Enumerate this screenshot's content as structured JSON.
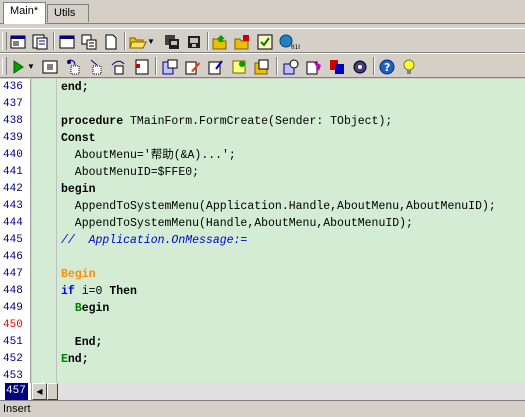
{
  "tabs": [
    {
      "label": "Main*",
      "active": true
    },
    {
      "label": "Utils",
      "active": false
    }
  ],
  "toolbar1_icons": [
    "view-unit-icon",
    "view-form-icon",
    "window-icon",
    "copy-window-icon",
    "new-file-icon",
    "open-folder-icon",
    "dropdown-arrow-icon",
    "save-all-icon",
    "compile-icon",
    "open-project-icon",
    "project-manager-icon",
    "checklist-icon",
    "component-icon"
  ],
  "toolbar2_icons": [
    "run-icon",
    "run-dropdown-icon",
    "pause-icon",
    "step-into-icon",
    "trace-icon",
    "step-over-icon",
    "bookmark-icon",
    "doc-edit-icon",
    "edit-icon",
    "highlight-icon",
    "notes-icon",
    "tools-icon",
    "find-icon",
    "packages-icon",
    "options-icon",
    "help-icon",
    "tips-icon"
  ],
  "gutter": {
    "line_numbers": [
      "436",
      "437",
      "438",
      "439",
      "440",
      "441",
      "442",
      "443",
      "444",
      "445",
      "446",
      "447",
      "448",
      "449",
      "450",
      "451",
      "452",
      "453",
      "457"
    ],
    "error_line": "450",
    "current_line": "457"
  },
  "code": {
    "l436": "end;",
    "l438_kw": "procedure",
    "l438_rest": " TMainForm.FormCreate(Sender: TObject);",
    "l439": "Const",
    "l440": "  AboutMenu='帮助(&A)...';",
    "l441": "  AboutMenuID=$FFE0;",
    "l442": "begin",
    "l443": "  AppendToSystemMenu(Application.Handle,AboutMenu,AboutMenuID);",
    "l444": "  AppendToSystemMenu(Handle,AboutMenu,AboutMenuID);",
    "l445": "//  Application.OnMessage:=",
    "l447": "Begin",
    "l448_kw": "if",
    "l448_mid": " i=0 ",
    "l448_kw2": "Then",
    "l449_a": "  ",
    "l449_b": "B",
    "l449_c": "egin",
    "l451": "  End;",
    "l452_a": "E",
    "l452_b": "nd;"
  },
  "status": {
    "mode": "Insert"
  },
  "colors": {
    "editor_bg": "#d4ecd4",
    "line_number": "#000080",
    "error_line": "#ff0000",
    "keyword_orange": "#ff8c00",
    "keyword_blue": "#0000ff",
    "comment": "#0000cc"
  }
}
